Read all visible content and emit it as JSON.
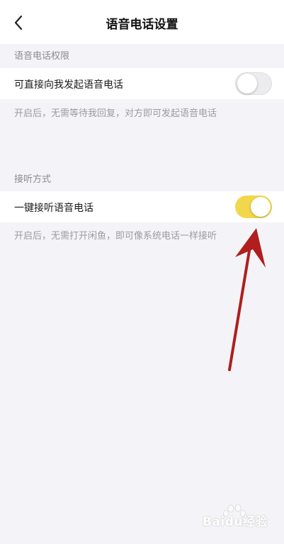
{
  "header": {
    "title": "语音电话设置",
    "back_icon": "chevron-left-icon"
  },
  "sections": [
    {
      "label": "语音电话权限",
      "row_label": "可直接向我发起语音电话",
      "toggle_on": false,
      "hint": "开启后，无需等待我回复，对方即可发起语音电话"
    },
    {
      "label": "接听方式",
      "row_label": "一键接听语音电话",
      "toggle_on": true,
      "hint": "开启后，无需打开闲鱼，即可像系统电话一样接听"
    }
  ],
  "colors": {
    "toggle_on": "#f2d74d",
    "arrow": "#b01e1e"
  },
  "watermark": {
    "text": "Baidu经验"
  }
}
